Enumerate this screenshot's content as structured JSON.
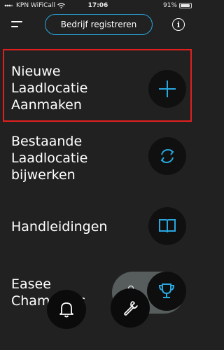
{
  "status_bar": {
    "carrier": "KPN WiFiCall",
    "time": "17:06",
    "battery_text": "91%",
    "battery_level": 0.91
  },
  "header": {
    "register_label": "Bedrijf registreren"
  },
  "menu": {
    "items": [
      {
        "label": "Nieuwe\nLaadlocatie\nAanmaken",
        "icon": "plus-icon"
      },
      {
        "label": "Bestaande\nLaadlocatie\nbijwerken",
        "icon": "sync-icon"
      },
      {
        "label": "Handleidingen",
        "icon": "book-icon"
      },
      {
        "label": "Easee\nChampions",
        "icon": "trophy-icon"
      }
    ]
  },
  "bottom_nav": {
    "icons": [
      "bell-icon",
      "wrench-icon"
    ]
  },
  "colors": {
    "background": "#212121",
    "accent": "#29a8e0",
    "highlight": "#e0201f"
  }
}
